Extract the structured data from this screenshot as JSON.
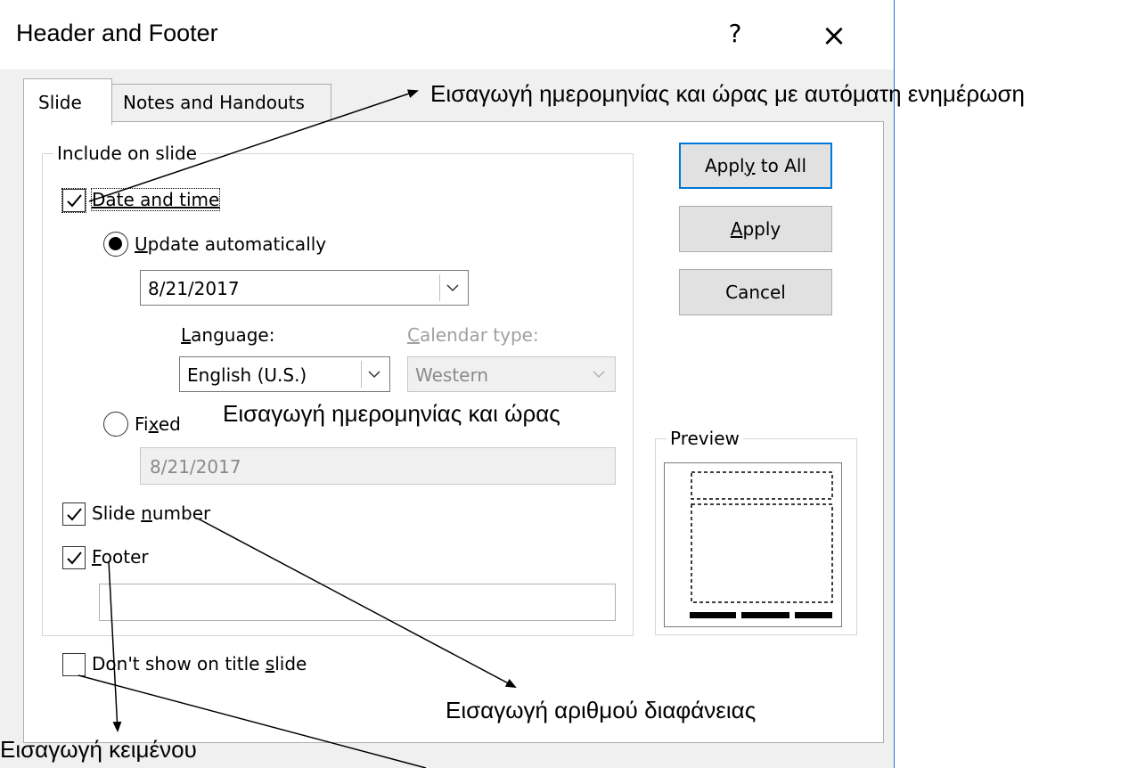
{
  "window": {
    "title": "Header and Footer",
    "help_label": "?",
    "close_label": "×"
  },
  "tabs": [
    {
      "label": "Slide"
    },
    {
      "label": "Notes and Handouts"
    }
  ],
  "include_group": {
    "label": "Include on slide",
    "date_time": {
      "label": "Date and time",
      "checked": true,
      "update_auto": {
        "label_key": "U",
        "label_rest": "pdate automatically",
        "date_value": "8/21/2017"
      },
      "language": {
        "label_key": "L",
        "label_rest": "anguage:",
        "value": "English (U.S.)"
      },
      "calendar": {
        "label_key": "C",
        "label_rest": "alendar type:",
        "value": "Western"
      },
      "fixed": {
        "label_a": "Fi",
        "label_key": "x",
        "label_b": "ed",
        "value": "8/21/2017"
      }
    },
    "slide_number": {
      "label_a": "Slide ",
      "label_key": "n",
      "label_b": "umber",
      "checked": true
    },
    "footer": {
      "label_key": "F",
      "label_rest": "ooter",
      "checked": true,
      "value": ""
    }
  },
  "dont_show": {
    "label_a": "Don't show on title ",
    "label_key": "s",
    "label_b": "lide",
    "checked": false
  },
  "buttons": {
    "apply_all": {
      "a": "Appl",
      "key": "y",
      "b": " to All"
    },
    "apply": {
      "key": "A",
      "b": "pply"
    },
    "cancel": "Cancel"
  },
  "preview_label": "Preview",
  "annotations": {
    "date_auto": "Εισαγωγή ημερομηνίας και ώρας με αυτόματη ενημέρωση",
    "date_fixed": "Εισαγωγή ημερομηνίας και ώρας",
    "slide_number": "Εισαγωγή αριθμού διαφάνειας",
    "text": "Εισαγωγή κειμένου"
  }
}
